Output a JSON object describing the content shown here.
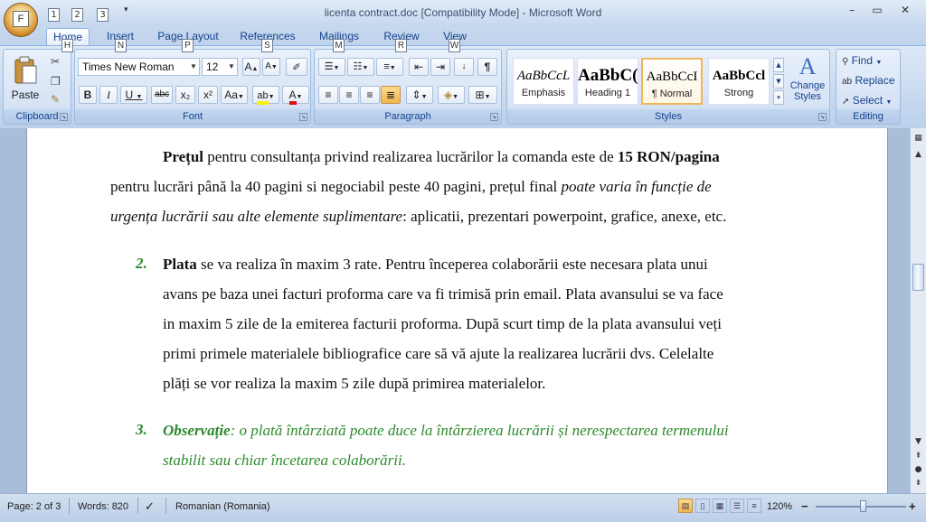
{
  "window": {
    "title": "licenta contract.doc [Compatibility Mode] - Microsoft Word",
    "office_key": "F",
    "qat_keys": [
      "1",
      "2",
      "3"
    ],
    "minimize": "–",
    "maximize": "▭",
    "close": "✕"
  },
  "tabs": [
    {
      "label": "Home",
      "key": "H",
      "active": true
    },
    {
      "label": "Insert",
      "key": "N"
    },
    {
      "label": "Page Layout",
      "key": "P"
    },
    {
      "label": "References",
      "key": "S"
    },
    {
      "label": "Mailings",
      "key": "M"
    },
    {
      "label": "Review",
      "key": "R"
    },
    {
      "label": "View",
      "key": "W"
    }
  ],
  "ribbon": {
    "clipboard": {
      "label": "Clipboard",
      "paste": "Paste"
    },
    "font": {
      "label": "Font",
      "font_name": "Times New Roman",
      "font_size": "12",
      "grow": "A",
      "shrink": "A",
      "bold": "B",
      "italic": "I",
      "underline": "U",
      "strike": "abc",
      "subscript": "x₂",
      "superscript": "x²",
      "change_case": "Aa",
      "font_color": "A"
    },
    "paragraph": {
      "label": "Paragraph",
      "pilcrow": "¶"
    },
    "styles": {
      "label": "Styles",
      "tiles": [
        {
          "sample": "AaBbCcL",
          "name": "Emphasis"
        },
        {
          "sample": "AaBbC(",
          "name": "Heading 1"
        },
        {
          "sample": "AaBbCcI",
          "name": "¶ Normal",
          "selected": true
        },
        {
          "sample": "AaBbCcl",
          "name": "Strong"
        }
      ],
      "change_styles": "Change\nStyles"
    },
    "editing": {
      "label": "Editing",
      "find": "Find",
      "replace": "Replace",
      "select": "Select"
    }
  },
  "document": {
    "p1": {
      "l1_bold": "Prețul",
      "l1_text": " pentru consultanța privind realizarea lucrărilor la comanda este de ",
      "l1_price": "15 RON/pagina",
      "l2_text": "pentru lucrări până la 40 pagini si negociabil peste 40 pagini, prețul final ",
      "l2_italic": "poate varia în funcție de",
      "l3_italic": "urgența lucrării  sau alte elemente suplimentare",
      "l3_text": ": aplicatii, prezentari powerpoint, grafice, anexe, etc."
    },
    "item2": {
      "number": "2.",
      "l1_bold": "Plata",
      "l1_text": " se va realiza în maxim 3 rate. Pentru începerea colaborării este necesara plata unui",
      "l2": "avans pe baza unei facturi proforma care va fi trimisă prin email. Plata avansului se va face",
      "l3": "in maxim 5 zile  de la emiterea facturii proforma. După scurt timp de la plata avansului veți",
      "l4": "primi   primele materialele bibliografice care să vă ajute la realizarea lucrării dvs. Celelalte",
      "l5": "plăți se vor realiza la maxim 5 zile după primirea materialelor."
    },
    "item3": {
      "number": "3.",
      "l1_bold": "Observație",
      "l1_text": ": o plată întârziată poate duce la întârzierea lucrării și nerespectarea termenului",
      "l2": "stabilit sau chiar încetarea colaborării."
    }
  },
  "statusbar": {
    "page": "Page: 2 of 3",
    "words": "Words: 820",
    "language": "Romanian (Romania)",
    "zoom": "120%",
    "zoom_minus": "−",
    "zoom_plus": "+",
    "zoom_fraction": 0.52
  },
  "colors": {
    "green_text": "#2c8a2c",
    "ribbon_blue": "#15428b"
  }
}
